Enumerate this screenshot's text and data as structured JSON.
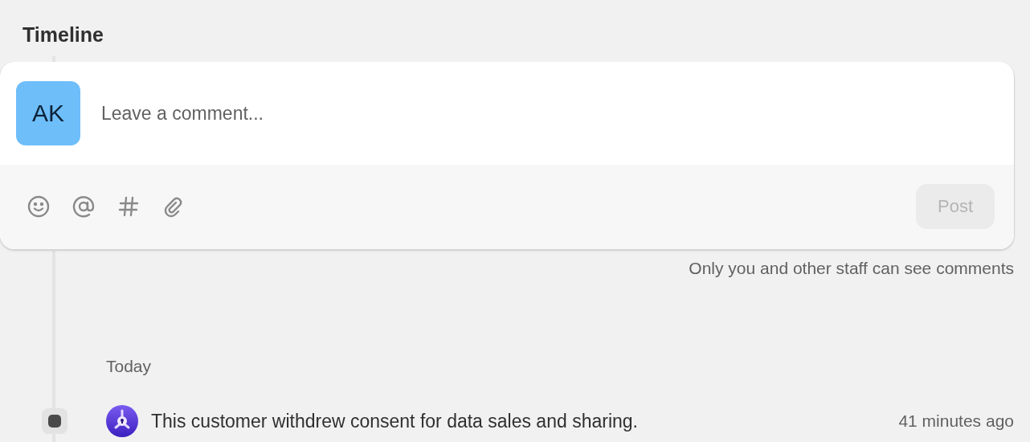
{
  "title": "Timeline",
  "composer": {
    "avatar": "AK",
    "placeholder": "Leave a comment...",
    "post_button": {
      "label": "Post",
      "disabled": true
    }
  },
  "note": "Only you and other staff can see comments",
  "groups": [
    {
      "heading": "Today",
      "events": [
        {
          "text": "This customer withdrew consent for data sales and sharing.",
          "time": "41 minutes ago"
        }
      ]
    }
  ]
}
